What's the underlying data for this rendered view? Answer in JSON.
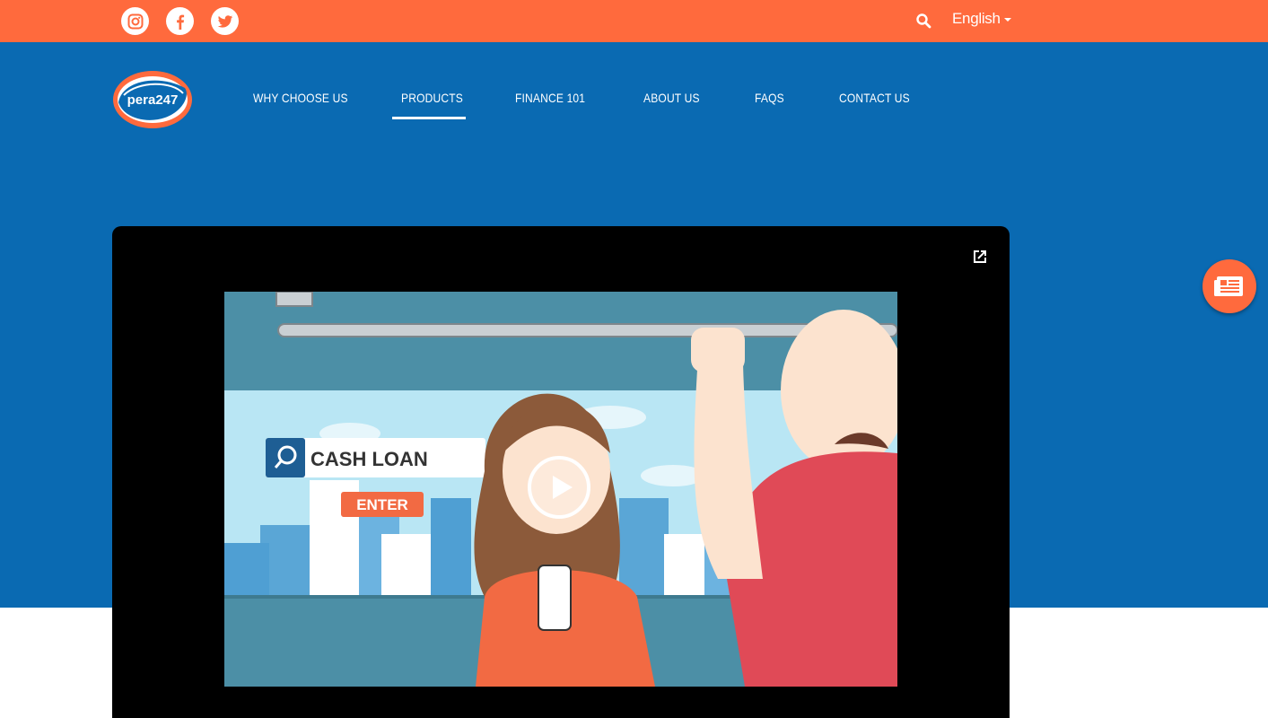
{
  "brand": {
    "logo_text": "pera247"
  },
  "topbar": {
    "social": [
      {
        "icon": "instagram-icon"
      },
      {
        "icon": "facebook-icon"
      },
      {
        "icon": "twitter-icon"
      }
    ],
    "search_icon": "search-icon",
    "language": "English"
  },
  "nav": {
    "items": [
      {
        "label": "WHY CHOOSE US"
      },
      {
        "label": "PRODUCTS",
        "active": true
      },
      {
        "label": "FINANCE 101"
      },
      {
        "label": "ABOUT US"
      },
      {
        "label": "FAQS"
      },
      {
        "label": "CONTACT US"
      }
    ]
  },
  "video": {
    "search_text": "CASH LOAN",
    "button_text": "ENTER",
    "popout_icon": "external-link-icon",
    "play_icon": "play-icon"
  },
  "fab": {
    "icon": "news-icon"
  },
  "colors": {
    "orange": "#FF6A3D",
    "blue": "#0A6AB2"
  }
}
